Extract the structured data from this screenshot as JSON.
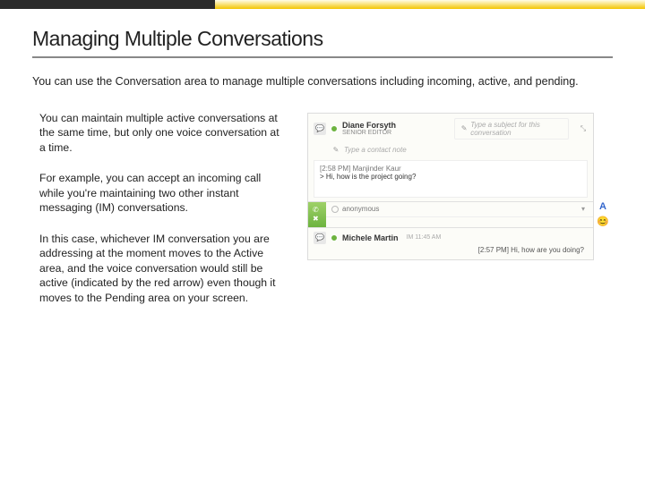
{
  "title": "Managing Multiple Conversations",
  "intro": "You can use the Conversation area to manage multiple conversations including incoming, active, and pending.",
  "paragraphs": [
    "You can maintain multiple active conversations at the same time, but only one voice conversation at a time.",
    "For example, you can accept an incoming call while you're maintaining two other instant messaging (IM) conversations.",
    "In this case, whichever IM conversation you are addressing at the moment moves to the Active area, and the voice conversation would still be active (indicated by the red arrow) even though it moves to the Pending area on your screen."
  ],
  "mock": {
    "conv1": {
      "name": "Diane Forsyth",
      "role": "SENIOR EDITOR",
      "subject_placeholder": "Type a subject for this conversation",
      "note_placeholder": "Type a contact note",
      "msg_meta": "[2:58 PM] Manjinder Kaur",
      "msg_text": "> Hi, how is the project going?"
    },
    "conv2": {
      "anon_label": "anonymous"
    },
    "conv3": {
      "name": "Michele Martin",
      "time_text": "[2:57 PM] Hi, how are you doing?"
    },
    "side": {
      "font_icon": "A",
      "emoji_icon": "😊"
    }
  }
}
